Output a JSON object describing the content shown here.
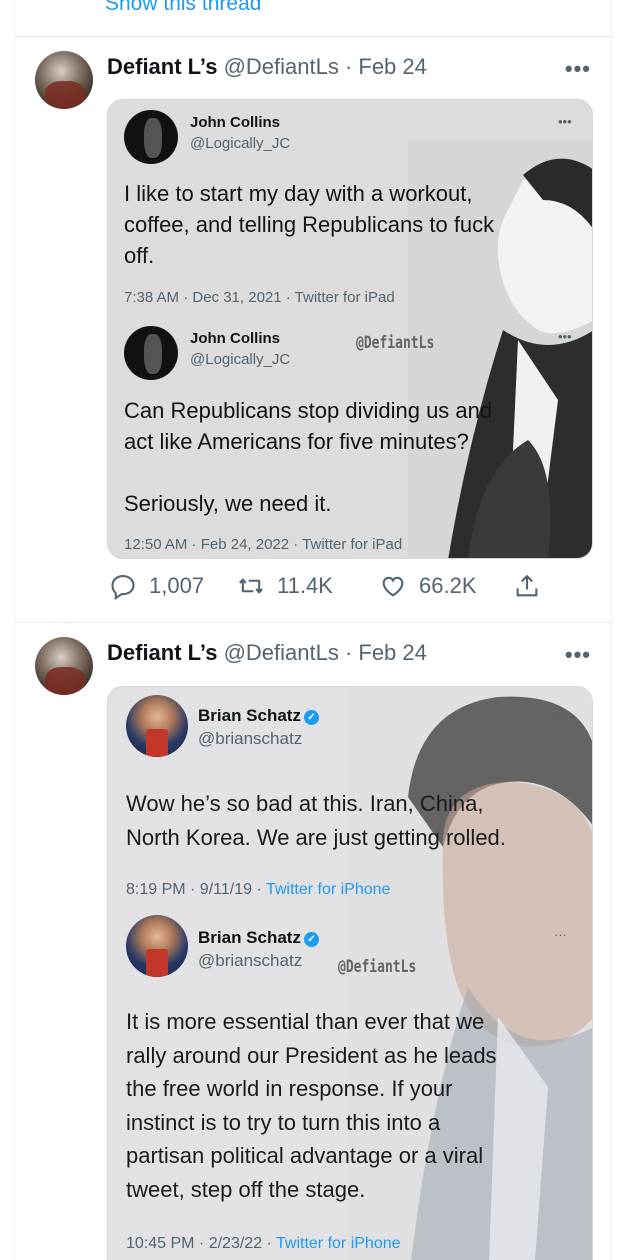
{
  "thread_link": "Show this thread",
  "tweets": [
    {
      "author_name": "Defiant L’s",
      "meta": "@DefiantLs · Feb 24",
      "more": "•••",
      "quote": {
        "more": "•••",
        "watermark": "@DefiantLs",
        "first": {
          "name": "John Collins",
          "handle": "@Logically_JC",
          "lines": [
            "I like to start my day with a workout,",
            "coffee, and telling Republicans to fuck",
            "off."
          ],
          "meta": "7:38 AM · Dec 31, 2021 · Twitter for iPad"
        },
        "second": {
          "name": "John Collins",
          "handle": "@Logically_JC",
          "lines": [
            "Can Republicans stop dividing us and",
            "act like Americans for five minutes?",
            "",
            "Seriously, we need it."
          ],
          "meta": "12:50 AM · Feb 24, 2022 · Twitter for iPad"
        }
      },
      "actions": {
        "replies": "1,007",
        "retweets": "11.4K",
        "likes": "66.2K"
      }
    },
    {
      "author_name": "Defiant L’s",
      "meta": "@DefiantLs · Feb 24",
      "more": "•••",
      "quote": {
        "more": "···",
        "watermark": "@DefiantLs",
        "first": {
          "name": "Brian Schatz",
          "handle": "@brianschatz",
          "lines": [
            "Wow he’s so bad at this. Iran, China,",
            "North Korea. We are just getting rolled."
          ],
          "meta_time": "8:19 PM · 9/11/19 · ",
          "meta_source": "Twitter for iPhone"
        },
        "second": {
          "name": "Brian Schatz",
          "handle": "@brianschatz",
          "lines": [
            "It is more essential than ever that we",
            "rally around our President as he leads",
            "the free world in response. If your",
            "instinct is to try to turn this into a",
            "partisan political advantage or a viral",
            "tweet, step off the stage."
          ],
          "meta_time": "10:45 PM · 2/23/22 · ",
          "meta_source": "Twitter for iPhone"
        }
      }
    }
  ],
  "colors": {
    "accent": "#1d9bf0",
    "muted": "#536471",
    "text": "#0f1419"
  },
  "icons": [
    "reply-icon",
    "retweet-icon",
    "like-icon",
    "share-icon",
    "verified-badge-icon",
    "more-icon"
  ]
}
